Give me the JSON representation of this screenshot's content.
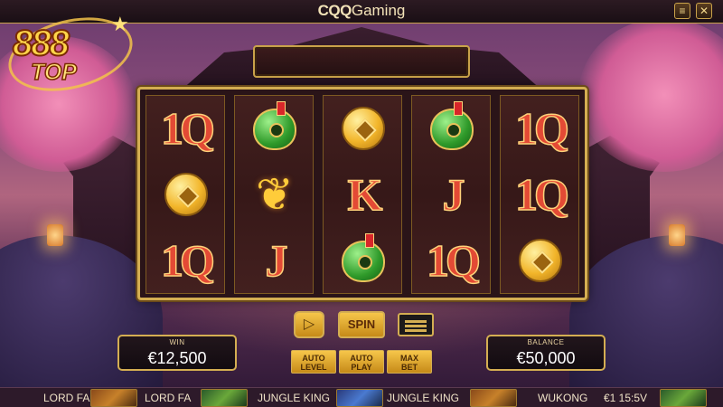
{
  "header": {
    "brand_cqq": "CQQ",
    "brand_gaming": "Gaming",
    "minimize_icon": "≡",
    "close_icon": "✕"
  },
  "logo": {
    "line1": "888",
    "line2": "TOP"
  },
  "reels": [
    [
      "1Q",
      "coin",
      "1Q"
    ],
    [
      "jade",
      "phoenix",
      "J"
    ],
    [
      "coin",
      "K",
      "jade"
    ],
    [
      "jade",
      "J",
      "1Q"
    ],
    [
      "1Q",
      "1Q",
      "coin"
    ]
  ],
  "controls": {
    "play_icon": "▷",
    "spin_label": "SPIN",
    "auto_level_1": "AUTO",
    "auto_level_2": "LEVEL",
    "auto_play_1": "AUTO",
    "auto_play_2": "PLAY",
    "max_bet_1": "MAX",
    "max_bet_2": "BET"
  },
  "meters": {
    "win_label": "WIN",
    "win_value": "€12,500",
    "balance_label": "BALANCE",
    "balance_value": "€50,000"
  },
  "game_strip": {
    "items": [
      "LORD FA",
      "LORD FA",
      "JUNGLE KING",
      "JUNGLE KING",
      "WUKONG",
      "€1 15:5V"
    ]
  },
  "colors": {
    "accent_gold": "#d4ae52",
    "reel_bg": "#43201f",
    "letter_red": "#e34a35"
  }
}
